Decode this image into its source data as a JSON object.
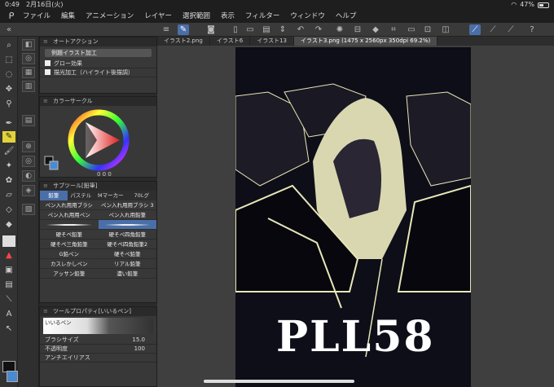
{
  "status": {
    "time": "0:49",
    "date": "2月16日(火)",
    "battery": "47%"
  },
  "menu": [
    "ファイル",
    "編集",
    "アニメーション",
    "レイヤー",
    "選択範囲",
    "表示",
    "フィルター",
    "ウィンドウ",
    "ヘルプ"
  ],
  "auto_action": {
    "title": "オートアクション",
    "set": "例題イラスト加工",
    "items": [
      "グロー効果",
      "描光加工（ハイライト後描調）"
    ]
  },
  "color_circle": {
    "title": "カラーサークル",
    "values": [
      "0",
      "0",
      "0"
    ]
  },
  "sub_tool": {
    "title": "サブツール[鉛筆]",
    "tabs": [
      "鉛筆",
      "パステル",
      "Mマーカー",
      "70Lグ"
    ],
    "brushes": [
      "ペン入れ用用ブラシ",
      "ペン入れ用用ブラシ 3",
      "ペン入れ用用ペン",
      "ペン入れ用鉛筆",
      "硬そぺ鉛筆",
      "硬そペ四角鉛筆",
      "硬そぺ三角鉛筆",
      "硬そぺ四角鉛筆2",
      "カスレかしペン",
      "リアル鉛筆",
      "アッサン鉛筆",
      "濃い鉛筆",
      "G鉛ペン",
      "硬そペ鉛筆"
    ]
  },
  "tool_prop": {
    "title": "ツールプロパティ[いいるペン]",
    "brush_name": "いいるペン",
    "size_label": "ブラシサイズ",
    "size_value": "15.0",
    "opacity_label": "不透明度",
    "opacity_value": "100",
    "aa_label": "アンチエイリアス"
  },
  "tabs": [
    "イラスト2.png",
    "イラスト6",
    "イラスト13",
    "イラスト3.png (1475 x 2560px 350dpi 69.2%)"
  ],
  "canvas_text": "PLL58",
  "colors": {
    "accent": "#4a6fa8",
    "canvas_bg": "#0e0e18"
  }
}
